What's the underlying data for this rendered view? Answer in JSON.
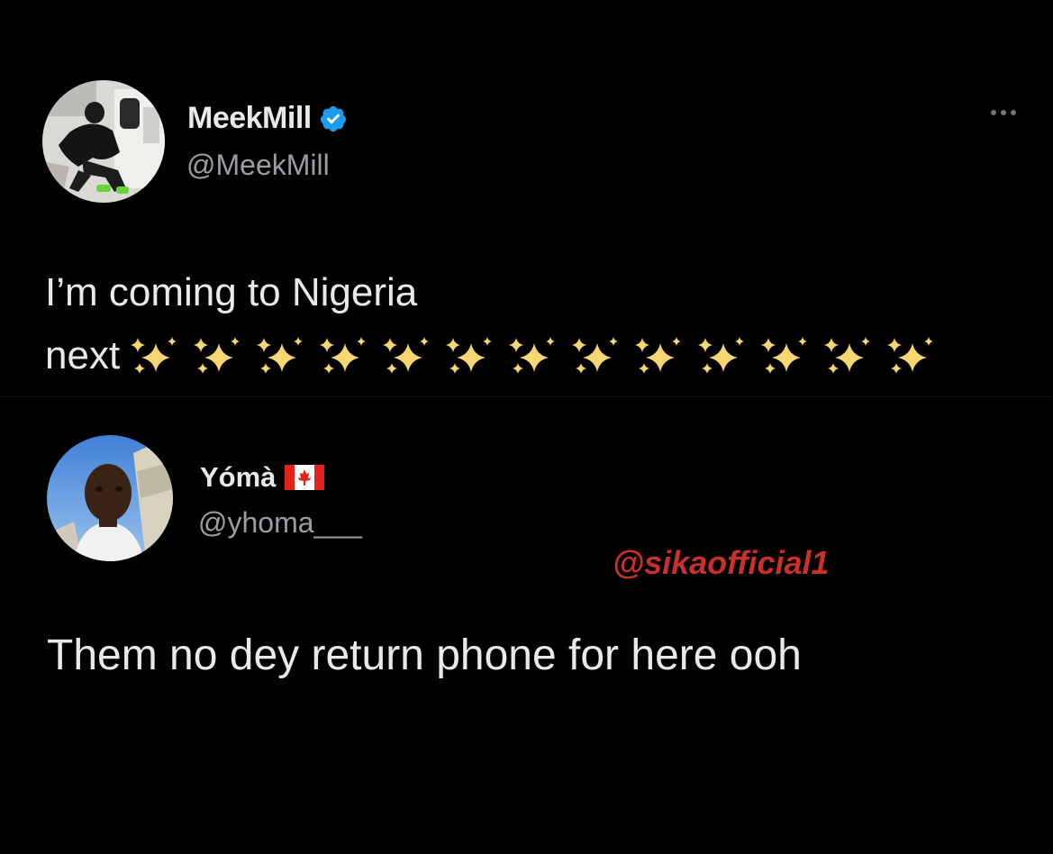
{
  "colors": {
    "background": "#000000",
    "text_primary": "#e7e9ea",
    "text_secondary": "#9a9ea3",
    "verified_blue": "#1d9bf0",
    "watermark_red": "#c8312a"
  },
  "tweet": {
    "author": {
      "display_name": "MeekMill",
      "handle": "@MeekMill",
      "verified": true,
      "verified_icon": "verified-badge-icon"
    },
    "more_icon": "more-options-icon",
    "text_line1": "I’m coming to Nigeria",
    "text_line2": "next",
    "sparkle_count": 13,
    "sparkle_icon": "sparkles-emoji"
  },
  "reply": {
    "author": {
      "display_name": "Yómà",
      "handle": "@yhoma___",
      "flag_icon": "canada-flag-icon"
    },
    "text": "Them no dey return phone for here ooh"
  },
  "watermark": "@sikaofficial1"
}
